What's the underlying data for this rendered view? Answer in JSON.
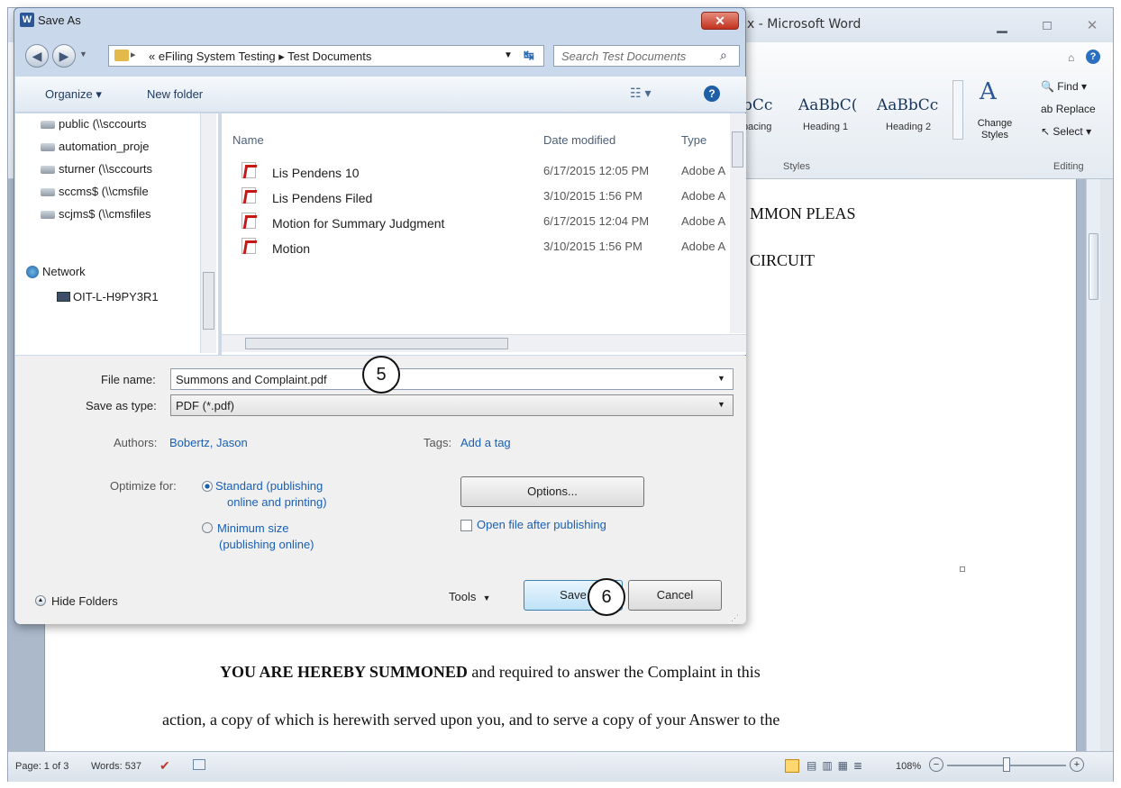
{
  "word": {
    "title": "x - Microsoft Word",
    "styles": [
      {
        "sample": "AaBbCc",
        "name": "Spacing",
        "shown_sample": "bCc",
        "shown_name": "pacing"
      },
      {
        "sample": "AaBbCc",
        "name": "Heading 1",
        "shown_sample": "AaBbC(",
        "shown_name": "Heading 1"
      },
      {
        "sample": "AaBbCc",
        "name": "Heading 2",
        "shown_sample": "AaBbCc",
        "shown_name": "Heading 2"
      }
    ],
    "change_styles": "Change Styles",
    "group_styles": "Styles",
    "group_editing": "Editing",
    "find": "Find",
    "replace": "Replace",
    "select": "Select",
    "doc_lines": {
      "line1": "MMON PLEAS",
      "line2": "CIRCUIT",
      "para_bold": "YOU ARE HEREBY SUMMONED",
      "para_rest": " and required to answer the Complaint in this",
      "para_line2": "action, a copy of which is herewith served upon you, and to serve a copy of your Answer to the"
    },
    "status": {
      "page": "Page: 1 of 3",
      "words": "Words: 537",
      "zoom": "108%"
    }
  },
  "dialog": {
    "title": "Save As",
    "breadcrumb": "« eFiling System Testing ▸ Test Documents",
    "search_placeholder": "Search Test Documents",
    "toolbar": {
      "organize": "Organize ▾",
      "new_folder": "New folder"
    },
    "tree": [
      {
        "label": "public (\\\\sccourts"
      },
      {
        "label": "automation_proje"
      },
      {
        "label": "sturner (\\\\sccourts"
      },
      {
        "label": "sccms$ (\\\\cmsfile"
      },
      {
        "label": "scjms$ (\\\\cmsfiles"
      }
    ],
    "network": "Network",
    "computer": "OIT-L-H9PY3R1",
    "columns": {
      "name": "Name",
      "date": "Date modified",
      "type": "Type"
    },
    "files": [
      {
        "name": "Lis Pendens 10",
        "date": "6/17/2015 12:05 PM",
        "type": "Adobe A"
      },
      {
        "name": "Lis Pendens Filed",
        "date": "3/10/2015 1:56 PM",
        "type": "Adobe A"
      },
      {
        "name": "Motion for Summary Judgment",
        "date": "6/17/2015 12:04 PM",
        "type": "Adobe A"
      },
      {
        "name": "Motion",
        "date": "3/10/2015 1:56 PM",
        "type": "Adobe A"
      }
    ],
    "file_name_label": "File name:",
    "file_name_value": "Summons and Complaint.pdf",
    "save_type_label": "Save as type:",
    "save_type_value": "PDF (*.pdf)",
    "authors_label": "Authors:",
    "authors_value": "Bobertz, Jason",
    "tags_label": "Tags:",
    "tags_value": "Add a tag",
    "optimize_label": "Optimize for:",
    "opt_standard_1": "Standard (publishing",
    "opt_standard_2": "online and printing)",
    "opt_min_1": "Minimum size",
    "opt_min_2": "(publishing online)",
    "options_button": "Options...",
    "open_after": "Open file after publishing",
    "hide_folders": "Hide Folders",
    "tools": "Tools",
    "save": "Save",
    "cancel": "Cancel"
  },
  "callouts": {
    "step5": "5",
    "step6": "6"
  }
}
